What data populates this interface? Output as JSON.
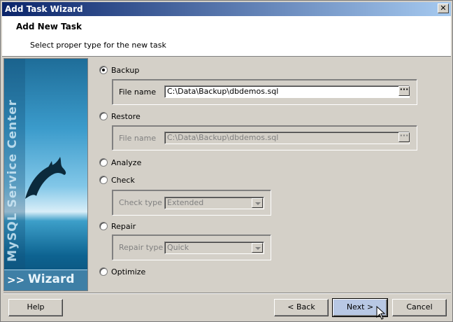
{
  "window": {
    "title": "Add Task Wizard",
    "close_glyph": "✕"
  },
  "header": {
    "title": "Add New Task",
    "subtitle": "Select proper type for the new task"
  },
  "banner": {
    "brand_text": "MySQL Service Center",
    "arrows": ">>",
    "wizard_label": "Wizard"
  },
  "options": {
    "backup": {
      "label": "Backup",
      "selected": true,
      "file_label": "File name",
      "file_value": "C:\\Data\\Backup\\dbdemos.sql"
    },
    "restore": {
      "label": "Restore",
      "selected": false,
      "file_label": "File name",
      "file_value": "C:\\Data\\Backup\\dbdemos.sql"
    },
    "analyze": {
      "label": "Analyze",
      "selected": false
    },
    "check": {
      "label": "Check",
      "selected": false,
      "type_label": "Check type",
      "type_value": "Extended"
    },
    "repair": {
      "label": "Repair",
      "selected": false,
      "type_label": "Repair type",
      "type_value": "Quick"
    },
    "optimize": {
      "label": "Optimize",
      "selected": false
    }
  },
  "buttons": {
    "help": "Help",
    "back": "< Back",
    "next": "Next >",
    "cancel": "Cancel",
    "ellipsis": "···"
  },
  "colors": {
    "title_start": "#0a246a",
    "title_end": "#a6caf0",
    "face": "#d4d0c8"
  }
}
